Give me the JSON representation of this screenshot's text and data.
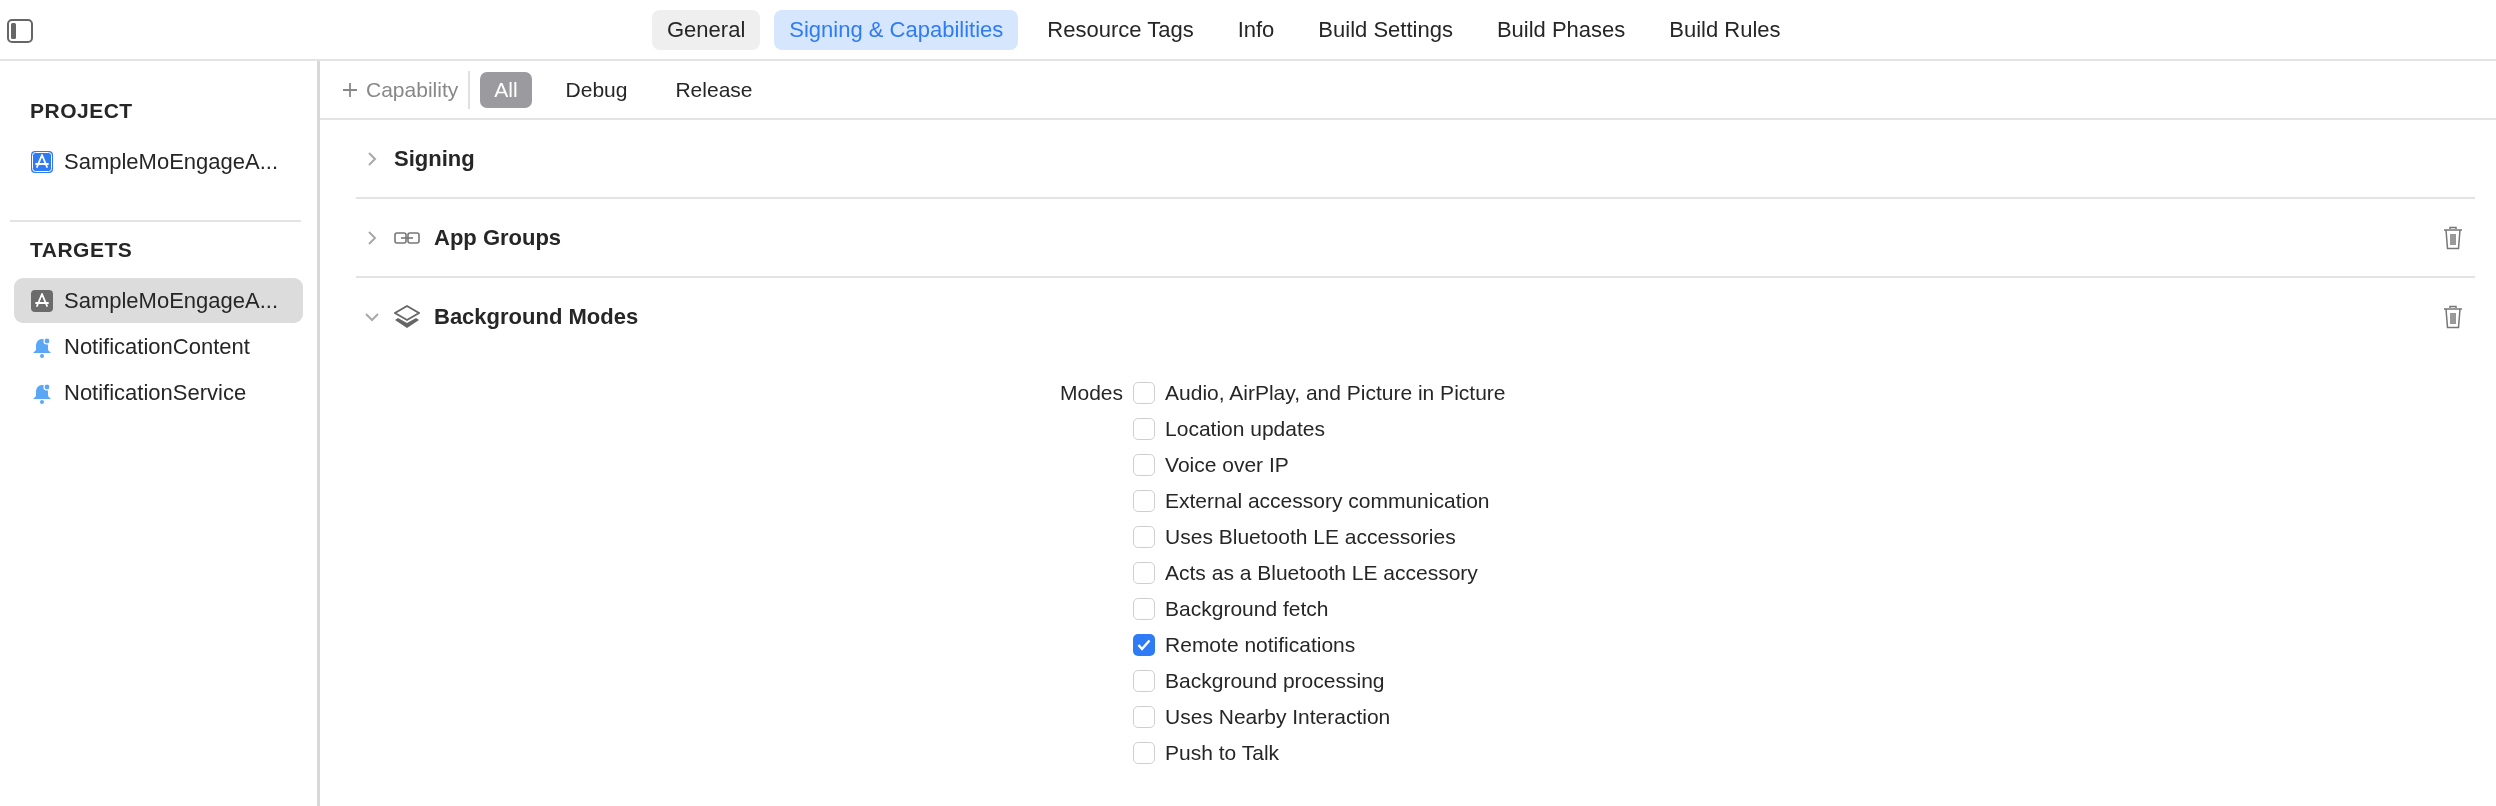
{
  "tabs": [
    {
      "label": "General",
      "selected": false
    },
    {
      "label": "Signing & Capabilities",
      "selected": true
    },
    {
      "label": "Resource Tags",
      "selected": false
    },
    {
      "label": "Info",
      "selected": false
    },
    {
      "label": "Build Settings",
      "selected": false
    },
    {
      "label": "Build Phases",
      "selected": false
    },
    {
      "label": "Build Rules",
      "selected": false
    }
  ],
  "sidebar": {
    "groups": [
      {
        "title": "PROJECT",
        "items": [
          {
            "label": "SampleMoEngageA...",
            "kind": "app",
            "selected": false
          }
        ]
      },
      {
        "title": "TARGETS",
        "items": [
          {
            "label": "SampleMoEngageA...",
            "kind": "app",
            "selected": true
          },
          {
            "label": "NotificationContent",
            "kind": "extension",
            "selected": false
          },
          {
            "label": "NotificationService",
            "kind": "extension",
            "selected": false
          }
        ]
      }
    ]
  },
  "toolbar": {
    "add_button": "Capability",
    "filters": [
      {
        "label": "All",
        "selected": true
      },
      {
        "label": "Debug",
        "selected": false
      },
      {
        "label": "Release",
        "selected": false
      }
    ]
  },
  "sections": [
    {
      "title": "Signing",
      "kind": "plain",
      "expanded": false,
      "removable": false
    },
    {
      "title": "App Groups",
      "kind": "link",
      "expanded": false,
      "removable": true
    },
    {
      "title": "Background Modes",
      "kind": "layers",
      "expanded": true,
      "removable": true,
      "label": "Modes",
      "options": [
        {
          "label": "Audio, AirPlay, and Picture in Picture",
          "checked": false
        },
        {
          "label": "Location updates",
          "checked": false
        },
        {
          "label": "Voice over IP",
          "checked": false
        },
        {
          "label": "External accessory communication",
          "checked": false
        },
        {
          "label": "Uses Bluetooth LE accessories",
          "checked": false
        },
        {
          "label": "Acts as a Bluetooth LE accessory",
          "checked": false
        },
        {
          "label": "Background fetch",
          "checked": false
        },
        {
          "label": "Remote notifications",
          "checked": true
        },
        {
          "label": "Background processing",
          "checked": false
        },
        {
          "label": "Uses Nearby Interaction",
          "checked": false
        },
        {
          "label": "Push to Talk",
          "checked": false
        }
      ]
    }
  ]
}
